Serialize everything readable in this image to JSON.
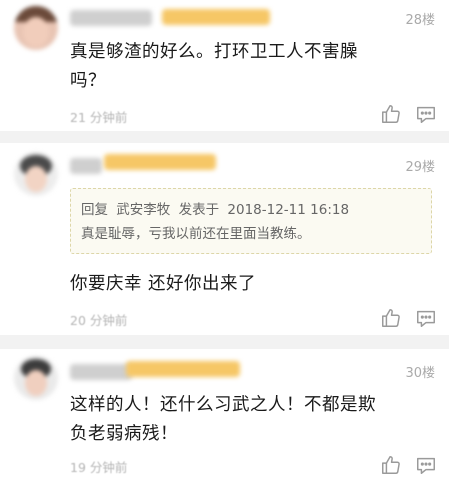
{
  "comments": [
    {
      "floor": "28楼",
      "text_line1": "真是够渣的好么。打环卫工人不害臊",
      "text_line2": "吗？",
      "time": "21 分钟前"
    },
    {
      "floor": "29楼",
      "reply": {
        "prefix": "回复",
        "author": "武安李牧",
        "verb": "发表于",
        "datetime": "2018-12-11 16:18",
        "text": "真是耻辱，亏我以前还在里面当教练。"
      },
      "text_line1": "你要庆幸 还好你出来了",
      "time": "20 分钟前"
    },
    {
      "floor": "30楼",
      "text_line1": "这样的人！还什么习武之人！不都是欺",
      "text_line2": "负老弱病残！",
      "time": "19 分钟前"
    }
  ],
  "icons": [
    "like-icon",
    "comment-icon"
  ],
  "colors": {
    "accent_name": "#f6c766",
    "divider": "#f2f2f2",
    "quote_bg": "#fbfaf2"
  }
}
